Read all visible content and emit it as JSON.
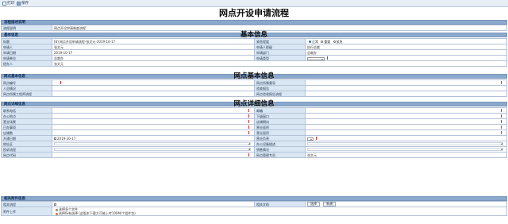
{
  "toolbar": {
    "print_label": "打印",
    "save_label": "保存"
  },
  "document": {
    "title": "网点开设申请流程"
  },
  "flow_desc": {
    "section_label": "流程描述说明",
    "label": "流程说明",
    "value": "网点开设申请制度流程"
  },
  "basic": {
    "section_label": "基本信息",
    "big_title": "基本信息",
    "rows": [
      {
        "l1": "标题",
        "v1": "[8] 网点开设申请流程-张文元-2019-10-17",
        "l2": "紧急程度",
        "opt1": "正常",
        "opt2": "重要",
        "opt3": "紧急"
      },
      {
        "l1": "申请人",
        "v1": "张文元",
        "l2": "申请人职级",
        "v2": "执行总裁"
      },
      {
        "l1": "申请日期",
        "v1": "2019-10-17",
        "l2": "申请部门",
        "v2": "总裁办"
      },
      {
        "l1": "申请单位",
        "v1": "总裁办",
        "l2": "申请类型",
        "v2": ""
      },
      {
        "l1": "经办人",
        "v1": "张文元"
      }
    ]
  },
  "outlet_basic": {
    "section_label": "网点基本信息",
    "big_title": "网点基本信息",
    "rows": [
      {
        "l1": "网点编号",
        "v1": "",
        "l2": "网点所属督导",
        "v2": ""
      },
      {
        "l1": "人员情况",
        "v1": "",
        "l2": "验收报告",
        "v2": ""
      },
      {
        "l1": "网点所属工程师流程",
        "v1": "",
        "l2": "网点验收报告流程",
        "v2": ""
      }
    ]
  },
  "outlet_detail": {
    "section_label": "网点详细信息",
    "big_title": "网点详细信息",
    "rows": [
      {
        "l1": "联系电话",
        "v1": "",
        "l2": "邮编",
        "v2": ""
      },
      {
        "l1": "办公地点",
        "v1": "",
        "l2": "下级窗口",
        "v2": ""
      },
      {
        "l1": "营业场景",
        "v1": "",
        "l2": "店铺朝向",
        "v2": ""
      },
      {
        "l1": "已办事项",
        "v1": "",
        "l2": "营业面积",
        "v2": ""
      },
      {
        "l1": "店铺数",
        "v1": "",
        "l2": "营业面积",
        "v2": ""
      },
      {
        "l1": "开通日期",
        "v1": "2019-10-17",
        "l2": "营业负责",
        "v2": ""
      }
    ],
    "tall_rows": [
      {
        "l1": "地址区",
        "l2": "办公设备描述"
      },
      {
        "l1": "投诉流程",
        "l2": "销售情况"
      }
    ],
    "last_row": {
      "l1": "网点代码",
      "v1": "",
      "l2": "网点管理专员",
      "v2": "张文元"
    }
  },
  "related": {
    "section_label": "相关附件信息",
    "rows": [
      {
        "l1": "相关流程",
        "v1": "",
        "l2": "相关文档",
        "btn1": "选择",
        "btn2": "新建"
      }
    ],
    "upload": {
      "label": "附件上传",
      "opt1": "选择多个文件",
      "opt2": "选择所有选择 (此版本下载大可能上传100M/个组件包)"
    }
  },
  "colors": {
    "section_bg": "#8aa9cd",
    "label_bg": "#d9e6f4",
    "required": "#e02020"
  }
}
